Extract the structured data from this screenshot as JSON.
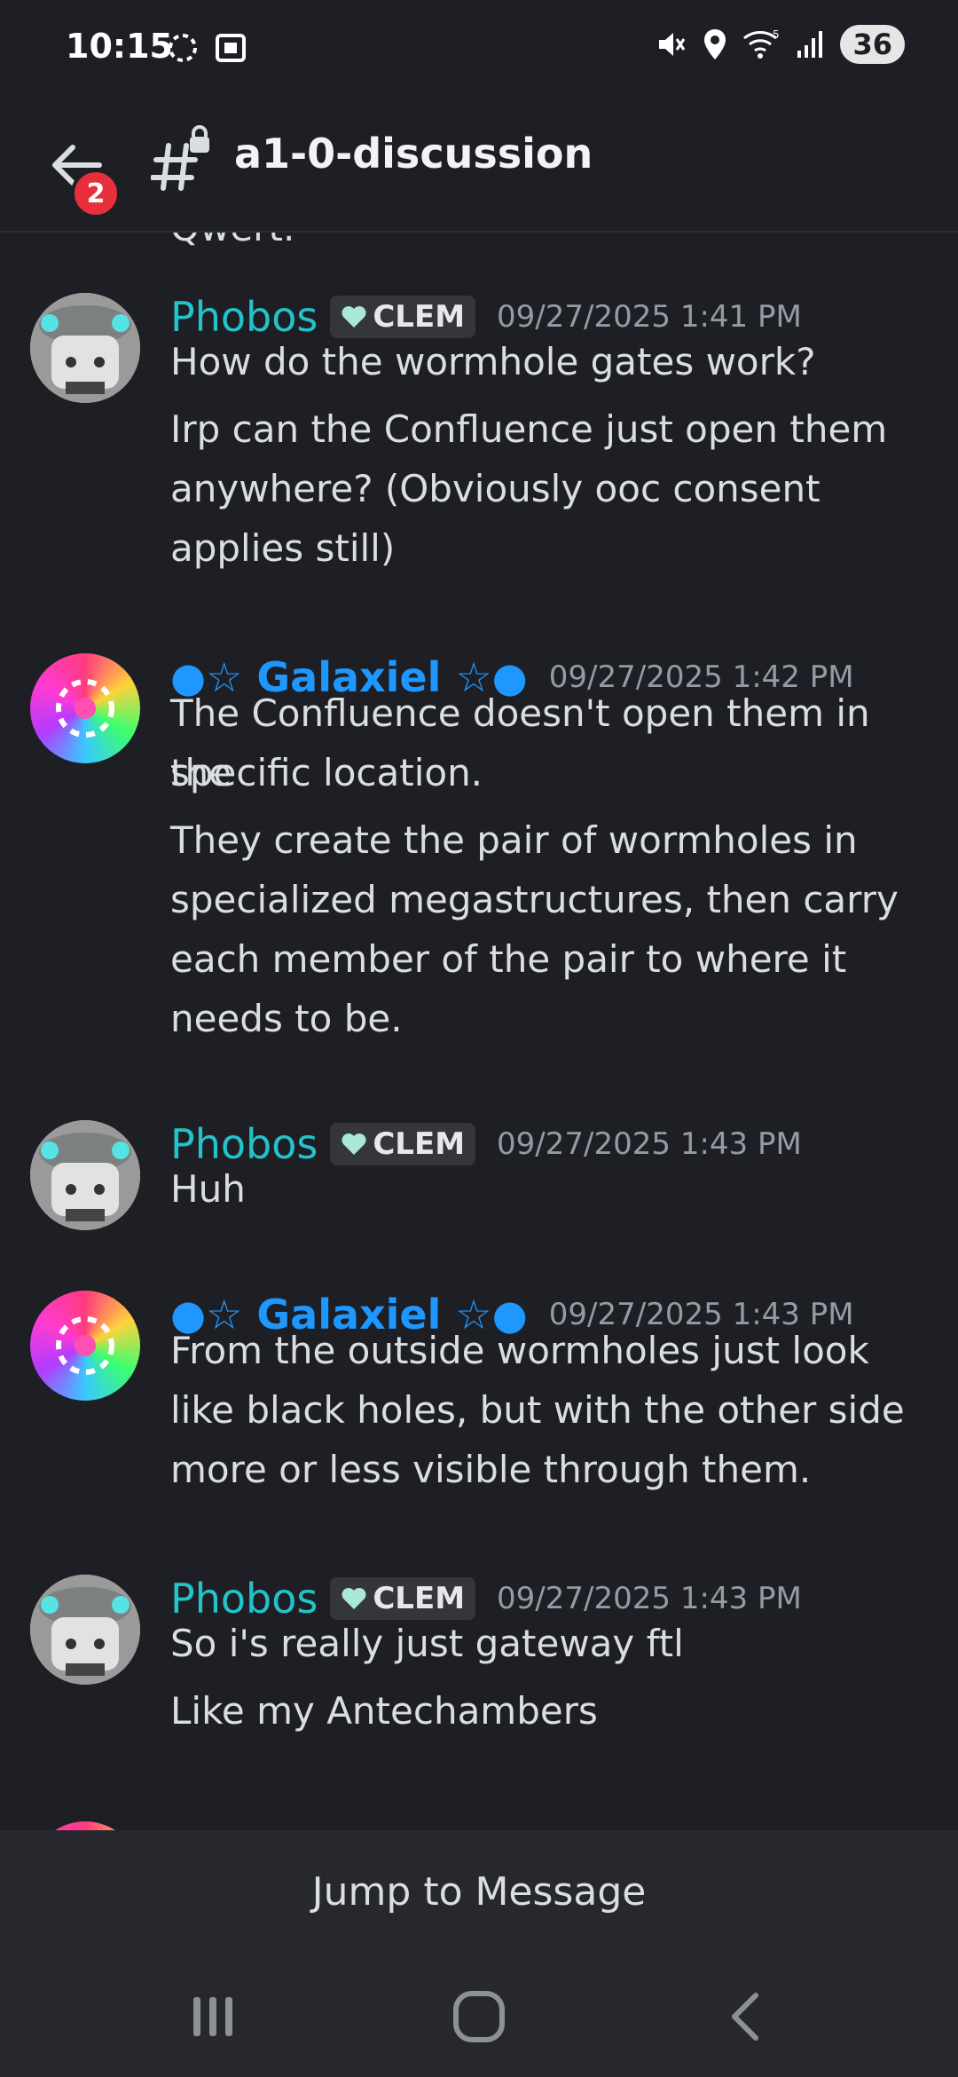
{
  "status": {
    "time": "10:15",
    "battery": "36",
    "net": "5"
  },
  "header": {
    "badge": "2",
    "title": "a1-0-discussion"
  },
  "cut_text": "Qwert.",
  "messages": [
    {
      "author": "Phobos",
      "tag": "CLEM",
      "time": "09/27/2025 1:41 PM",
      "lines": [
        "How do the wormhole gates work?",
        "Irp can the Confluence just open them",
        "anywhere? (Obviously ooc consent",
        "applies still)"
      ]
    },
    {
      "author": "Galaxiel",
      "time": "09/27/2025 1:42 PM",
      "lines": [
        "The Confluence doesn't open them in the",
        "specific location.",
        "They create the pair of wormholes in",
        "specialized megastructures, then carry",
        "each member of the pair to where it",
        "needs to be."
      ]
    },
    {
      "author": "Phobos",
      "tag": "CLEM",
      "time": "09/27/2025 1:43 PM",
      "lines": [
        "Huh"
      ]
    },
    {
      "author": "Galaxiel",
      "time": "09/27/2025 1:43 PM",
      "lines": [
        "From the outside wormholes just look",
        "like black holes, but with the other side",
        "more or less visible through them."
      ]
    },
    {
      "author": "Phobos",
      "tag": "CLEM",
      "time": "09/27/2025 1:43 PM",
      "lines": [
        "So i's really just gateway ftl",
        "Like my Antechambers"
      ]
    }
  ],
  "jump_label": "Jump to Message",
  "colors": {
    "background": "#1e1f24",
    "phobos": "#22c3c9",
    "galaxiel": "#1e97ff",
    "badge": "#e7303b"
  }
}
